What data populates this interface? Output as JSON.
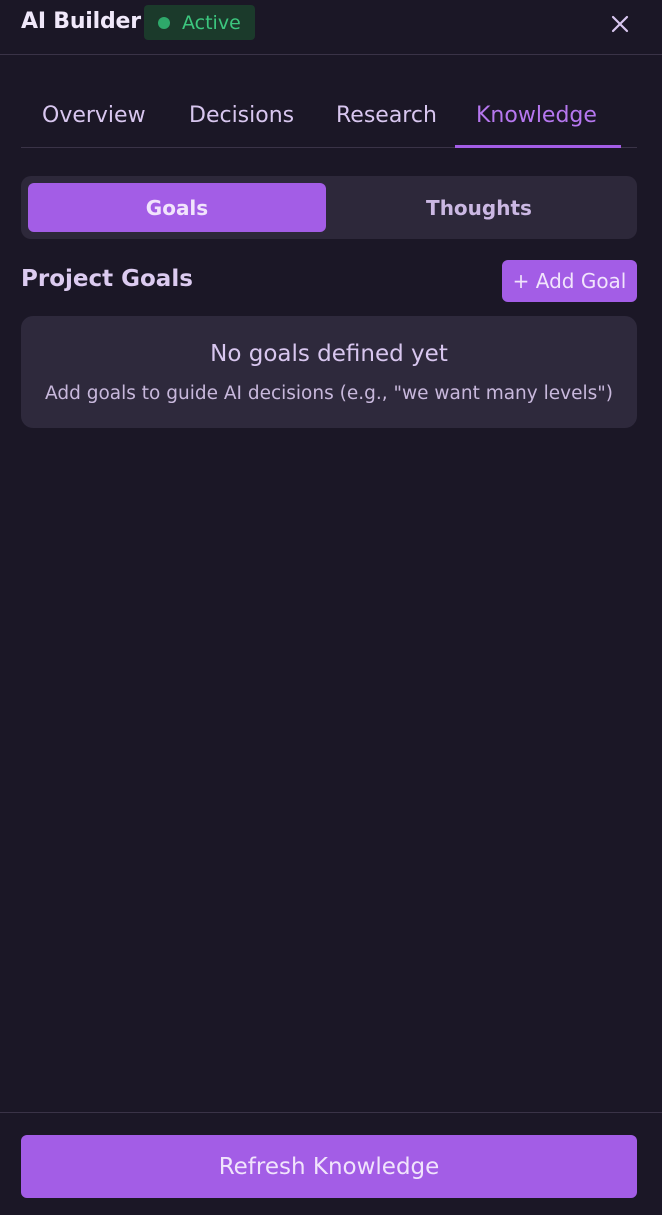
{
  "header": {
    "title": "AI Builder",
    "status": "Active",
    "status_color": "#3cc67e",
    "close_icon": "close-icon"
  },
  "tabs": [
    {
      "label": "Overview",
      "active": false
    },
    {
      "label": "Decisions",
      "active": false
    },
    {
      "label": "Research",
      "active": false
    },
    {
      "label": "Knowledge",
      "active": true
    }
  ],
  "subtabs": [
    {
      "label": "Goals",
      "active": true
    },
    {
      "label": "Thoughts",
      "active": false
    }
  ],
  "goals": {
    "section_title": "Project Goals",
    "add_button_label": "+ Add Goal",
    "empty_title": "No goals defined yet",
    "empty_description": "Add goals to guide AI decisions (e.g., \"we want many levels\")"
  },
  "footer": {
    "refresh_label": "Refresh Knowledge"
  },
  "colors": {
    "background": "#1b1726",
    "accent": "#a35de6",
    "active_tab": "#b677ef"
  }
}
